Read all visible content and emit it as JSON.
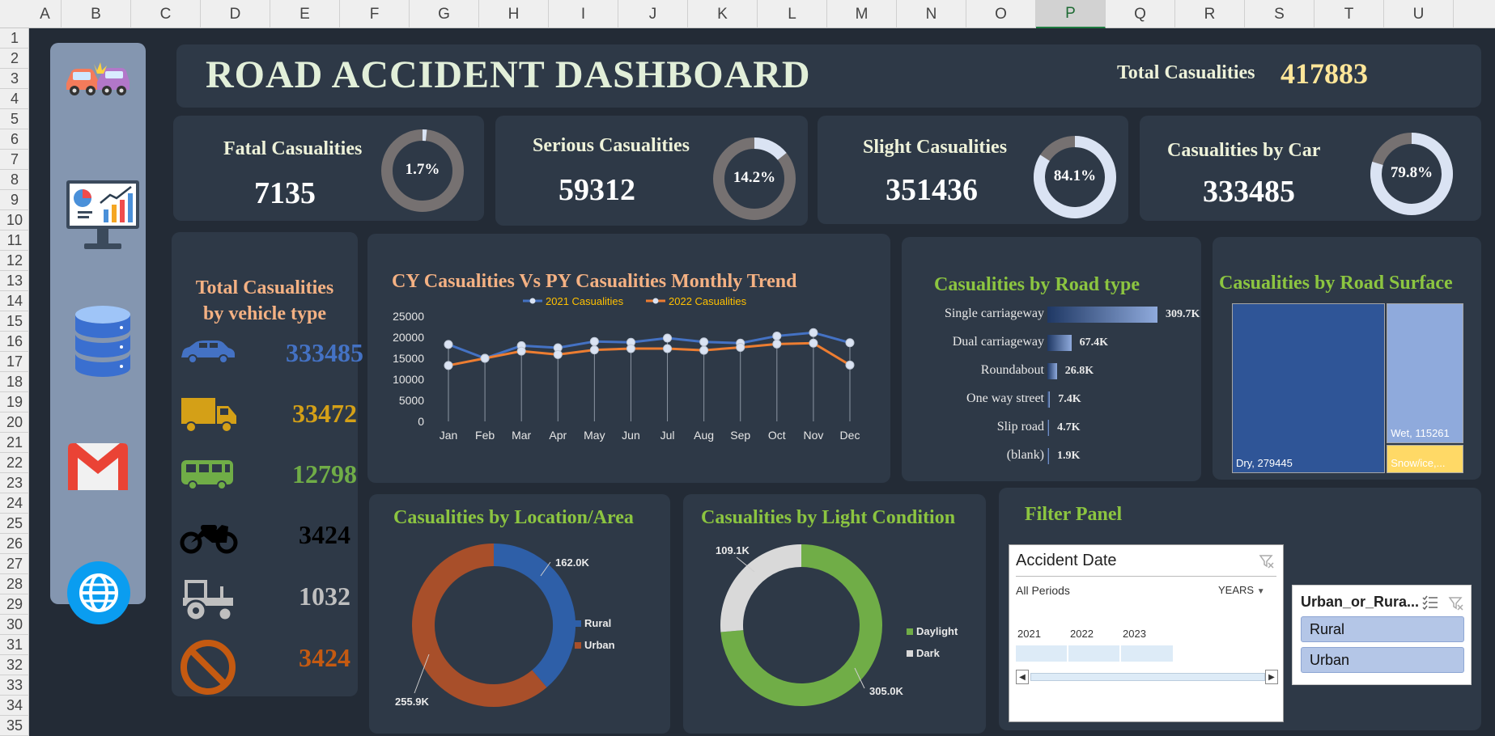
{
  "sheet": {
    "columns": [
      "A",
      "B",
      "C",
      "D",
      "E",
      "F",
      "G",
      "H",
      "I",
      "J",
      "K",
      "L",
      "M",
      "N",
      "O",
      "P",
      "Q",
      "R",
      "S",
      "T",
      "U"
    ],
    "selected_column": "P",
    "rows": [
      "1",
      "2",
      "3",
      "4",
      "5",
      "6",
      "7",
      "8",
      "9",
      "10",
      "11",
      "12",
      "13",
      "14",
      "15",
      "16",
      "17",
      "18",
      "19",
      "20",
      "21",
      "22",
      "23",
      "24",
      "25",
      "26",
      "27",
      "28",
      "29",
      "30",
      "31",
      "32",
      "33",
      "34",
      "35"
    ]
  },
  "header": {
    "title": "ROAD ACCIDENT DASHBOARD",
    "total_label": "Total Casualities",
    "total_value": "417883"
  },
  "sidebar": {
    "icons": [
      "car-crash-icon",
      "analytics-monitor-icon",
      "database-icon",
      "gmail-icon",
      "globe-icon"
    ]
  },
  "kpis": [
    {
      "title": "Fatal Casualities",
      "value": "7135",
      "percent_label": "1.7%",
      "fraction": 0.017
    },
    {
      "title": "Serious Casualities",
      "value": "59312",
      "percent_label": "14.2%",
      "fraction": 0.142
    },
    {
      "title": "Slight Casualities",
      "value": "351436",
      "percent_label": "84.1%",
      "fraction": 0.841
    },
    {
      "title": "Casualities by Car",
      "value": "333485",
      "percent_label": "79.8%",
      "fraction": 0.798
    }
  ],
  "vehicle": {
    "title_line1": "Total Casualities",
    "title_line2": "by vehicle type",
    "items": [
      {
        "icon": "car-icon",
        "value": "333485",
        "color": "#4472c4"
      },
      {
        "icon": "truck-icon",
        "value": "33472",
        "color": "#d4a017"
      },
      {
        "icon": "bus-icon",
        "value": "12798",
        "color": "#70ad47"
      },
      {
        "icon": "motorcycle-icon",
        "value": "3424",
        "color": "#000000"
      },
      {
        "icon": "tractor-icon",
        "value": "1032",
        "color": "#bfbfbf"
      },
      {
        "icon": "no-symbol-icon",
        "value": "3424",
        "color": "#c55a11"
      }
    ]
  },
  "colors": {
    "series_2021": "#4472c4",
    "series_2022": "#ed7d31",
    "rural": "#2e5fa8",
    "urban": "#a84f2a",
    "daylight": "#70ad47",
    "dark": "#d9d9d9",
    "dry": "#2f5597",
    "wet": "#8faadc",
    "snow": "#ffd966"
  },
  "chart_data": [
    {
      "type": "line",
      "title": "CY Casualities Vs PY Casualities Monthly Trend",
      "categories": [
        "Jan",
        "Feb",
        "Mar",
        "Apr",
        "May",
        "Jun",
        "Jul",
        "Aug",
        "Sep",
        "Oct",
        "Nov",
        "Dec"
      ],
      "series": [
        {
          "name": "2021 Casualities",
          "values": [
            18300,
            15000,
            18000,
            17500,
            19000,
            18800,
            19800,
            18900,
            18600,
            20300,
            21100,
            18700
          ]
        },
        {
          "name": "2022 Casualities",
          "values": [
            13300,
            15000,
            16700,
            15900,
            17000,
            17300,
            17300,
            16900,
            17600,
            18400,
            18600,
            13400
          ]
        }
      ],
      "ylim": [
        0,
        25000
      ],
      "yticks": [
        "0",
        "5000",
        "10000",
        "15000",
        "20000",
        "25000"
      ],
      "legend": "top"
    },
    {
      "type": "bar",
      "title": "Casualities by Road type",
      "categories": [
        "Single carriageway",
        "Dual carriageway",
        "Roundabout",
        "One way street",
        "Slip road",
        "(blank)"
      ],
      "values": [
        309700,
        67400,
        26800,
        7400,
        4700,
        1900
      ],
      "labels": [
        "309.7K",
        "67.4K",
        "26.8K",
        "7.4K",
        "4.7K",
        "1.9K"
      ]
    },
    {
      "type": "area",
      "title": "Casualities by Road Surface",
      "categories": [
        "Dry",
        "Wet",
        "Snow/ice"
      ],
      "values": [
        279445,
        115261,
        23177
      ],
      "labels": [
        "Dry, 279445",
        "Wet, 115261",
        "Snow/ice,..."
      ]
    },
    {
      "type": "pie",
      "title": "Casualities by Location/Area",
      "categories": [
        "Rural",
        "Urban"
      ],
      "values": [
        162000,
        255900
      ],
      "labels": [
        "162.0K",
        "255.9K"
      ],
      "legend": "right"
    },
    {
      "type": "pie",
      "title": "Casualities by Light Condition",
      "categories": [
        "Daylight",
        "Dark"
      ],
      "values": [
        305000,
        109100
      ],
      "labels": [
        "305.0K",
        "109.1K"
      ],
      "legend": "right"
    }
  ],
  "filter": {
    "title": "Filter Panel",
    "date_slicer": {
      "title": "Accident Date",
      "all_periods": "All Periods",
      "granularity": "YEARS",
      "years": [
        "2021",
        "2022",
        "2023"
      ]
    },
    "area_slicer": {
      "title": "Urban_or_Rura...",
      "options": [
        "Rural",
        "Urban"
      ]
    }
  }
}
